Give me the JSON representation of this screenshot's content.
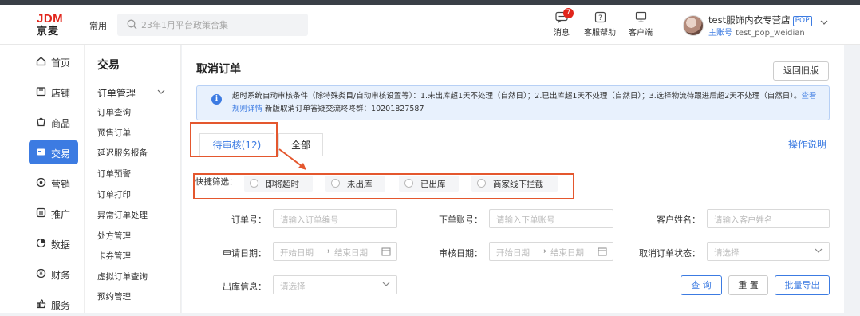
{
  "topbar": {
    "logo_line1": "JDM",
    "logo_line2": "京麦",
    "usual_label": "常用",
    "search_placeholder": "23年1月平台政策合集",
    "messages": {
      "label": "消息",
      "badge": "7"
    },
    "support_label": "客服帮助",
    "client_label": "客户端",
    "user": {
      "name": "test服饰内衣专营店",
      "tag": "POP",
      "role": "主账号",
      "account": "test_pop_weidian"
    }
  },
  "sidebar": {
    "items": [
      {
        "label": "首页",
        "icon": "home-icon"
      },
      {
        "label": "店铺",
        "icon": "store-icon"
      },
      {
        "label": "商品",
        "icon": "goods-icon"
      },
      {
        "label": "交易",
        "icon": "trade-icon",
        "active": true
      },
      {
        "label": "营销",
        "icon": "marketing-icon"
      },
      {
        "label": "推广",
        "icon": "promotion-icon"
      },
      {
        "label": "数据",
        "icon": "data-icon"
      },
      {
        "label": "财务",
        "icon": "finance-icon"
      },
      {
        "label": "服务",
        "icon": "service-icon"
      }
    ]
  },
  "subnav": {
    "title": "交易",
    "group": "订单管理",
    "items": [
      "订单查询",
      "预售订单",
      "延迟服务报备",
      "订单预警",
      "订单打印",
      "异常订单处理",
      "处方管理",
      "卡券管理",
      "虚拟订单查询",
      "预约管理"
    ]
  },
  "main": {
    "title": "取消订单",
    "back_button": "返回旧版",
    "notice": {
      "text": "超时系统自动审核条件（除特殊类目/自动审核设置等）：1.未出库超1天不处理（自然日）；2.已出库超1天不处理（自然日）；3.选择物流待跟进后超2天不处理（自然日）。",
      "link": "查看规则详情",
      "suffix": " 新版取消订单答疑交流咚咚群：10201827587"
    },
    "tabs": [
      {
        "label": "待审核(12)",
        "active": true
      },
      {
        "label": "全部"
      }
    ],
    "help_link": "操作说明",
    "quick_filter": {
      "label": "快捷筛选：",
      "options": [
        "即将超时",
        "未出库",
        "已出库",
        "商家线下拦截"
      ]
    },
    "form": {
      "order_no": {
        "label": "订单号：",
        "placeholder": "请输入订单编号"
      },
      "account": {
        "label": "下单账号：",
        "placeholder": "请输入下单账号"
      },
      "customer": {
        "label": "客户姓名：",
        "placeholder": "请输入客户姓名"
      },
      "apply_date": {
        "label": "申请日期：",
        "start": "开始日期",
        "end": "结束日期"
      },
      "review_date": {
        "label": "审核日期：",
        "start": "开始日期",
        "end": "结束日期"
      },
      "cancel_status": {
        "label": "取消订单状态：",
        "placeholder": "请选择"
      },
      "outbound": {
        "label": "出库信息：",
        "placeholder": "请选择"
      }
    },
    "buttons": {
      "query": "查 询",
      "reset": "重 置",
      "export": "批量导出"
    }
  }
}
